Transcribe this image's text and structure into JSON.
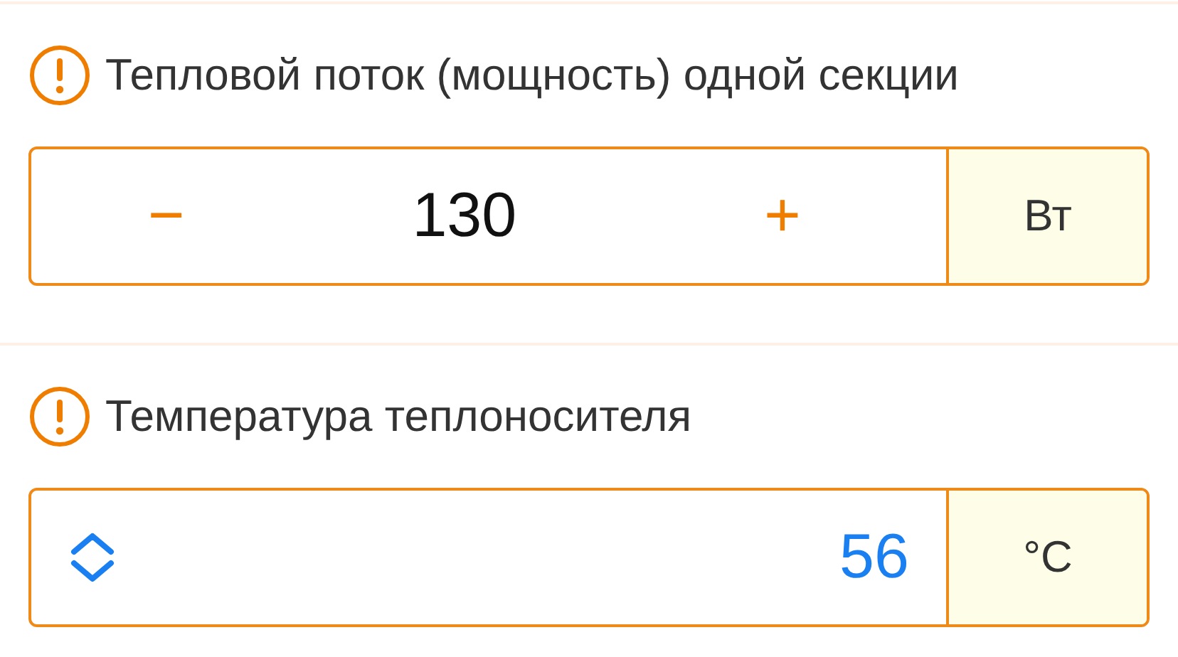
{
  "sections": [
    {
      "kind": "stepper",
      "label": "Тепловой поток (мощность) одной секции",
      "minus": "−",
      "value": "130",
      "plus": "+",
      "unit": "Вт"
    },
    {
      "kind": "picker",
      "label": "Температура теплоносителя",
      "value": "56",
      "unit": "°C"
    }
  ]
}
